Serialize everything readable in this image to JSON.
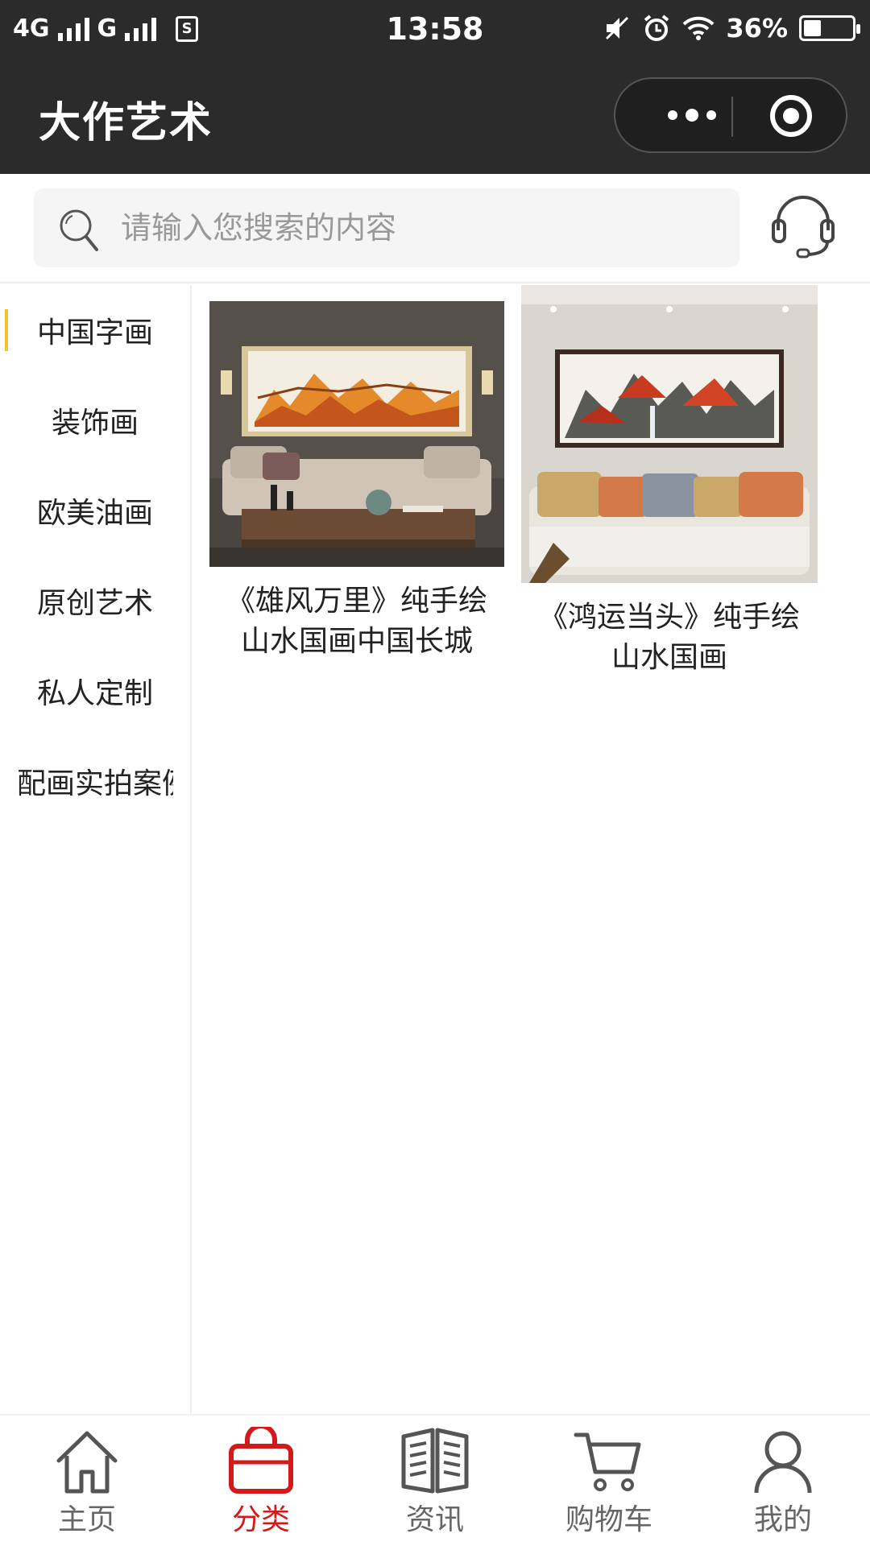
{
  "status_bar": {
    "network_left": "4G",
    "network_right": "G",
    "time": "13:58",
    "battery": "36%",
    "battery_level": 0.36
  },
  "title_bar": {
    "title": "大作艺术"
  },
  "search": {
    "placeholder": "请输入您搜索的内容"
  },
  "sidebar": {
    "items": [
      {
        "label": "中国字画",
        "active": true
      },
      {
        "label": "装饰画",
        "active": false
      },
      {
        "label": "欧美油画",
        "active": false
      },
      {
        "label": "原创艺术",
        "active": false
      },
      {
        "label": "私人定制",
        "active": false
      },
      {
        "label": "配画实拍案例",
        "active": false
      }
    ]
  },
  "products": [
    {
      "title": "《雄风万里》纯手绘山水国画中国长城"
    },
    {
      "title": "《鸿运当头》纯手绘山水国画"
    }
  ],
  "tabbar": {
    "items": [
      {
        "label": "主页",
        "icon": "home-icon",
        "active": false
      },
      {
        "label": "分类",
        "icon": "shopping-bag-icon",
        "active": true
      },
      {
        "label": "资讯",
        "icon": "news-book-icon",
        "active": false
      },
      {
        "label": "购物车",
        "icon": "cart-icon",
        "active": false
      },
      {
        "label": "我的",
        "icon": "user-icon",
        "active": false
      }
    ]
  },
  "colors": {
    "header_bg": "#2b2b2b",
    "active_tab": "#d21a1a",
    "sidebar_indicator": "#f2c230"
  }
}
